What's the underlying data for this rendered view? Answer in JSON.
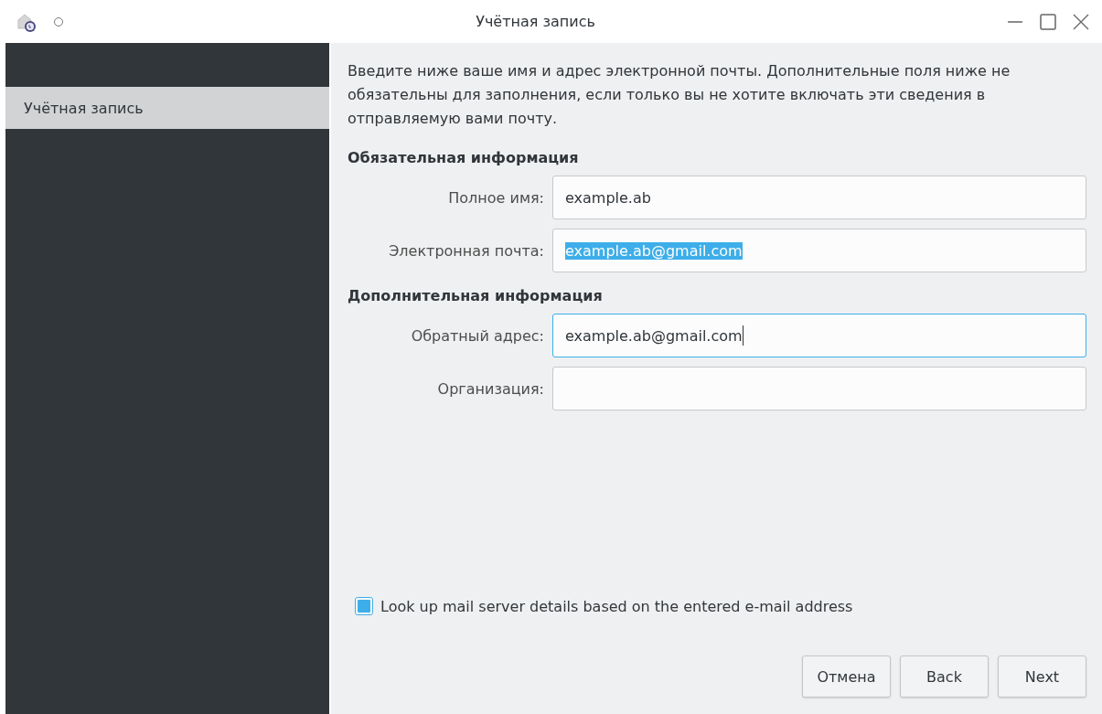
{
  "window": {
    "title": "Учётная запись"
  },
  "sidebar": {
    "items": [
      {
        "label": "Учётная запись",
        "selected": true
      }
    ]
  },
  "intro": "Введите ниже ваше имя и адрес электронной почты. Дополнительные поля ниже не обязательны для заполнения, если только вы не хотите включать эти сведения в отправляемую вами почту.",
  "sections": [
    {
      "title": "Обязательная информация",
      "fields": [
        {
          "label": "Полное имя:",
          "value": "example.ab",
          "focused": false,
          "text_selected": false
        },
        {
          "label": "Электронная почта:",
          "value": "example.ab@gmail.com",
          "focused": false,
          "text_selected": true
        }
      ]
    },
    {
      "title": "Дополнительная информация",
      "fields": [
        {
          "label": "Обратный адрес:",
          "value": "example.ab@gmail.com",
          "focused": true,
          "text_selected": false
        },
        {
          "label": "Организация:",
          "focused": false
        }
      ]
    }
  ],
  "lookup": {
    "label": "Look up mail server details based on the entered e-mail address",
    "checked": true
  },
  "buttons": [
    "Отмена",
    "Back",
    "Next"
  ]
}
